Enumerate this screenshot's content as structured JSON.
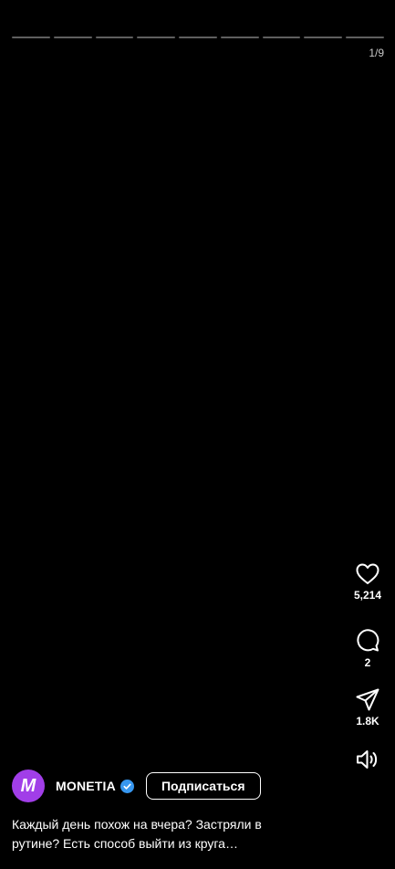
{
  "story": {
    "segments_total": 9,
    "counter": "1/9"
  },
  "actions": {
    "likes": "5,214",
    "comments": "2",
    "shares": "1.8K",
    "icons": [
      "heart-icon",
      "comment-icon",
      "share-icon",
      "speaker-icon"
    ]
  },
  "author": {
    "avatar_letter": "M",
    "name": "MONETIA",
    "verified": true,
    "follow_label": "Подписаться",
    "avatar_color": "#a13ee8"
  },
  "caption": "Каждый день похож на вчера? Застряли в рутине? Есть способ выйти из круга…",
  "colors": {
    "background": "#000000",
    "verified_badge": "#3797f0"
  }
}
